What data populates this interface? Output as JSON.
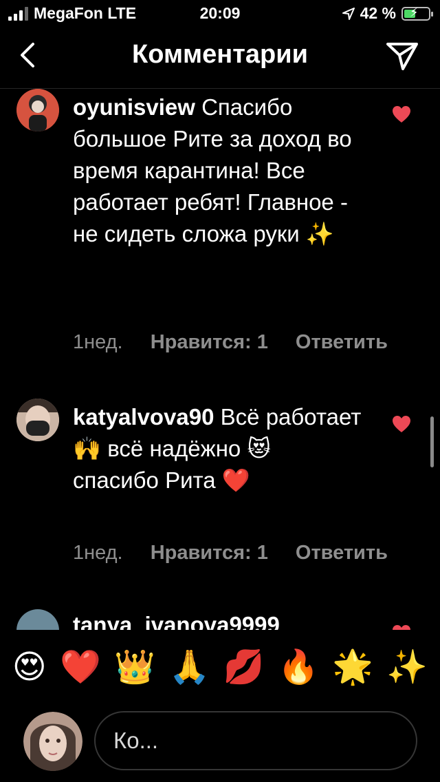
{
  "status_bar": {
    "carrier": "MegaFon LTE",
    "time": "20:09",
    "battery_percent": "42 %",
    "battery_level": 0.42
  },
  "header": {
    "title": "Комментарии"
  },
  "comments": [
    {
      "username": "oyunisview",
      "text": "Спасибо большое Рите за доход во время карантина! Все работает ребят! Главное - не сидеть сложа руки ✨",
      "age": "1нед.",
      "likes": "Нравится: 1",
      "reply": "Ответить"
    },
    {
      "username": "katyalvova90",
      "text": "Всё работает 🙌 всё надёжно 😻 спасибо Рита ❤️",
      "age": "1нед.",
      "likes": "Нравится: 1",
      "reply": "Ответить"
    },
    {
      "username": "tanya_ivanova9999"
    }
  ],
  "emoji_bar": [
    "😍",
    "❤️",
    "👑",
    "🙏",
    "💋",
    "🔥",
    "🌟",
    "✨"
  ],
  "input": {
    "placeholder": "Ко..."
  },
  "colors": {
    "background": "#000000",
    "heart": "#ed4956",
    "muted": "#8e8e8e",
    "battery": "#4cd964"
  }
}
